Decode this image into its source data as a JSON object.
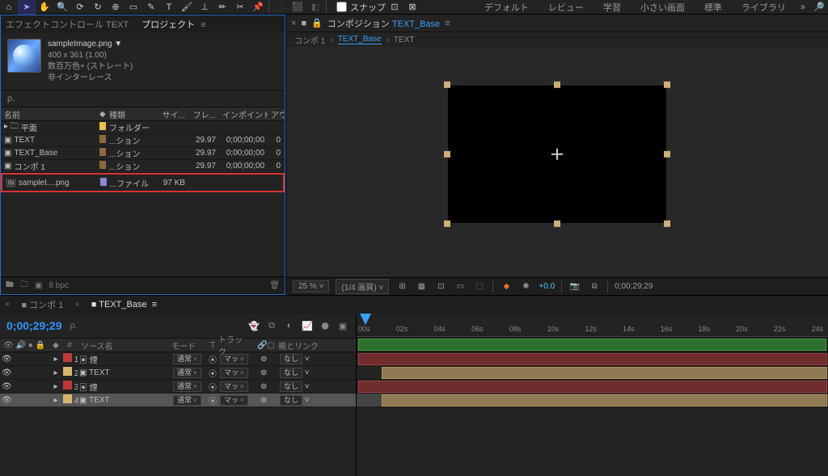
{
  "toolbar": {
    "snap_label": "スナップ",
    "workspaces": [
      "デフォルト",
      "レビュー",
      "学習",
      "小さい画面",
      "標準",
      "ライブラリ"
    ]
  },
  "project": {
    "tabs": {
      "effect": "エフェクトコントロール TEXT",
      "project": "プロジェクト"
    },
    "info": {
      "name": "sampleImage.png ▼",
      "dims": "400 x 361 (1.00)",
      "color": "数百万色+ (ストレート)",
      "interlace": "非インターレース"
    },
    "search_placeholder": "ρ.",
    "cols": {
      "name": "名前",
      "label": "",
      "type": "種類",
      "size": "サイ...",
      "fr": "フレ...",
      "in": "インポイント",
      "out": "アウ"
    },
    "items": [
      {
        "icon": "folder",
        "name": "平面",
        "sw": "#e6c04b",
        "type": "フォルダー",
        "size": "",
        "fr": "",
        "in": "",
        "out": ""
      },
      {
        "icon": "comp",
        "name": "TEXT",
        "sw": "#8a6a3a",
        "type": "...ション",
        "size": "",
        "fr": "29.97",
        "in": "0;00;00;00",
        "out": "0"
      },
      {
        "icon": "comp",
        "name": "TEXT_Base",
        "sw": "#8a6a3a",
        "type": "...ション",
        "size": "",
        "fr": "29.97",
        "in": "0;00;00;00",
        "out": "0"
      },
      {
        "icon": "comp",
        "name": "コンポ 1",
        "sw": "#8a6a3a",
        "type": "...ション",
        "size": "",
        "fr": "29.97",
        "in": "0;00;00;00",
        "out": "0"
      },
      {
        "icon": "file",
        "name": "sampleI....png",
        "sw": "#8a8ad0",
        "type": "...ファイル",
        "size": "97 KB",
        "fr": "",
        "in": "",
        "out": "",
        "hl": true
      }
    ],
    "footer_bpc": "8 bpc"
  },
  "viewer": {
    "tab_prefix": "コンポジション",
    "tab_comp": "TEXT_Base",
    "bc": [
      "コンポ 1",
      "TEXT_Base",
      "TEXT"
    ],
    "footer": {
      "zoom": "25 %",
      "quality": "(1/4 画質)",
      "exposure": "+0.0",
      "time": "0;00;29;29"
    }
  },
  "timeline": {
    "tabs": [
      "コンポ 1",
      "TEXT_Base"
    ],
    "active_tab": 1,
    "time": "0;00;29;29",
    "search_placeholder": "ρ.",
    "cols": {
      "num": "#",
      "source": "ソース名",
      "mode": "モード",
      "t": "T",
      "trk": "トラック...",
      "link_icon": "",
      "parent": "親とリンク"
    },
    "mode_value": "通常",
    "trk_value": "マッ",
    "parent_value": "なし",
    "layers": [
      {
        "n": 1,
        "sw": "#c03838",
        "name": "煙",
        "selected": false,
        "bar": "red",
        "bar_start": 0,
        "bar_len": 1
      },
      {
        "n": 2,
        "sw": "#d6b56f",
        "name": "TEXT",
        "selected": false,
        "bar": "tan",
        "bar_start": 0.05,
        "bar_len": 0.95
      },
      {
        "n": 3,
        "sw": "#c03838",
        "name": "煙",
        "selected": false,
        "bar": "red",
        "bar_start": 0,
        "bar_len": 1
      },
      {
        "n": 4,
        "sw": "#d6b56f",
        "name": "TEXT",
        "selected": true,
        "bar": "tan",
        "bar_start": 0.05,
        "bar_len": 0.95
      }
    ],
    "ruler": [
      "00s",
      "02s",
      "04s",
      "06s",
      "08s",
      "10s",
      "12s",
      "14s",
      "16s",
      "18s",
      "20s",
      "22s",
      "24s"
    ]
  }
}
